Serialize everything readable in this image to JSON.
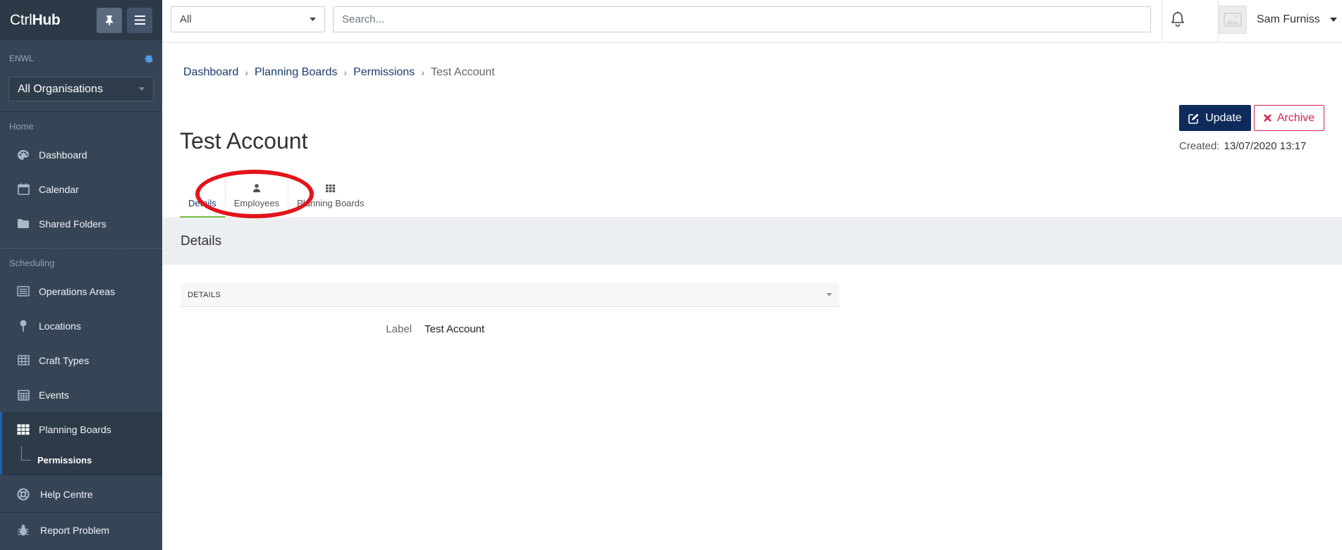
{
  "sidebar": {
    "brand_light": "Ctrl",
    "brand_bold": "Hub",
    "pin_icon": "pin-icon",
    "menu_icon": "hamburger-icon",
    "org_code": "ENWL",
    "org_select": "All Organisations",
    "sections": [
      {
        "label": "Home",
        "items": [
          {
            "label": "Dashboard",
            "icon": "palette-icon"
          },
          {
            "label": "Calendar",
            "icon": "calendar-icon"
          },
          {
            "label": "Shared Folders",
            "icon": "folder-icon"
          }
        ]
      },
      {
        "label": "Scheduling",
        "items": [
          {
            "label": "Operations Areas",
            "icon": "list-icon"
          },
          {
            "label": "Locations",
            "icon": "map-pin-icon"
          },
          {
            "label": "Craft Types",
            "icon": "table-icon"
          },
          {
            "label": "Events",
            "icon": "calendar-grid-icon"
          },
          {
            "label": "Planning Boards",
            "icon": "grid-icon",
            "active": true
          }
        ]
      }
    ],
    "sub_item": "Permissions",
    "bottom": [
      {
        "label": "Help Centre",
        "icon": "lifebuoy-icon"
      },
      {
        "label": "Report Problem",
        "icon": "bug-icon"
      }
    ]
  },
  "topbar": {
    "scope": "All",
    "search_placeholder": "Search...",
    "user_name": "Sam Furniss"
  },
  "breadcrumb": [
    "Dashboard",
    "Planning Boards",
    "Permissions",
    "Test Account"
  ],
  "page": {
    "title": "Test Account",
    "update_label": "Update",
    "archive_label": "Archive",
    "created_label": "Created:",
    "created_value": "13/07/2020 13:17"
  },
  "tabs": [
    {
      "label": "Details",
      "icon": "",
      "active": true
    },
    {
      "label": "Employees",
      "icon": "user-icon"
    },
    {
      "label": "Planning Boards",
      "icon": "grid-icon"
    }
  ],
  "section": {
    "title": "Details",
    "panel_header": "DETAILS",
    "fields": [
      {
        "label": "Label",
        "value": "Test Account"
      }
    ]
  },
  "colors": {
    "sidebar_bg": "#364556",
    "primary": "#0e2b5c",
    "danger": "#d6224e",
    "tab_active_underline": "#7ac143",
    "annotation": "#e3141b"
  }
}
